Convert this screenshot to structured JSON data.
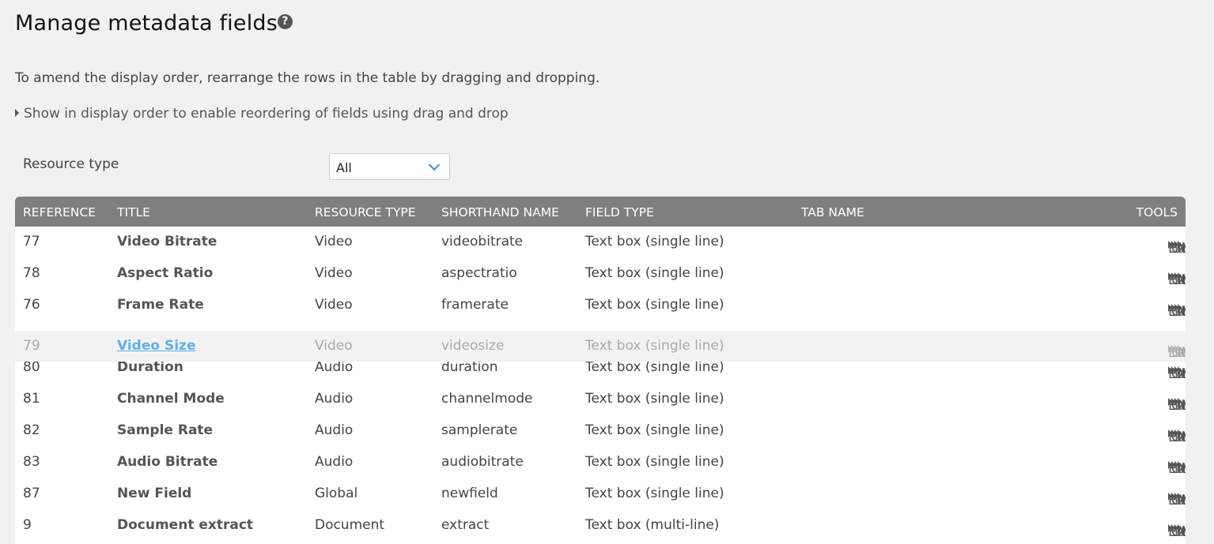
{
  "title": "Manage metadata fields",
  "help_icon": "question-circle-icon",
  "intro": "To amend the display order, rearrange the rows in the table by dragging and dropping.",
  "toggle": "Show in display order to enable reordering of fields using drag and drop",
  "filter": {
    "label": "Resource type",
    "value": "All"
  },
  "columns": [
    "REFERENCE",
    "TITLE",
    "RESOURCE TYPE",
    "SHORTHAND NAME",
    "FIELD TYPE",
    "TAB NAME",
    "TOOLS"
  ],
  "tools": [
    "Edit",
    "Copy",
    "Move up",
    "Move down"
  ],
  "rows": [
    {
      "ref": "77",
      "title": "Video Bitrate",
      "type": "Video",
      "short": "videobitrate",
      "field": "Text box (single line)",
      "tab": ""
    },
    {
      "ref": "78",
      "title": "Aspect Ratio",
      "type": "Video",
      "short": "aspectratio",
      "field": "Text box (single line)",
      "tab": ""
    },
    {
      "ref": "76",
      "title": "Frame Rate",
      "type": "Video",
      "short": "framerate",
      "field": "Text box (single line)",
      "tab": ""
    },
    {
      "ref": "80",
      "title": "Duration",
      "type": "Audio",
      "short": "duration",
      "field": "Text box (single line)",
      "tab": ""
    },
    {
      "ref": "81",
      "title": "Channel Mode",
      "type": "Audio",
      "short": "channelmode",
      "field": "Text box (single line)",
      "tab": ""
    },
    {
      "ref": "82",
      "title": "Sample Rate",
      "type": "Audio",
      "short": "samplerate",
      "field": "Text box (single line)",
      "tab": ""
    },
    {
      "ref": "83",
      "title": "Audio Bitrate",
      "type": "Audio",
      "short": "audiobitrate",
      "field": "Text box (single line)",
      "tab": ""
    },
    {
      "ref": "87",
      "title": "New Field",
      "type": "Global",
      "short": "newfield",
      "field": "Text box (single line)",
      "tab": ""
    },
    {
      "ref": "9",
      "title": "Document extract",
      "type": "Document",
      "short": "extract",
      "field": "Text box (multi-line)",
      "tab": ""
    }
  ],
  "dragged": {
    "ref": "79",
    "title": "Video Size",
    "type": "Video",
    "short": "videosize",
    "field": "Text box (single line)",
    "tab": ""
  }
}
